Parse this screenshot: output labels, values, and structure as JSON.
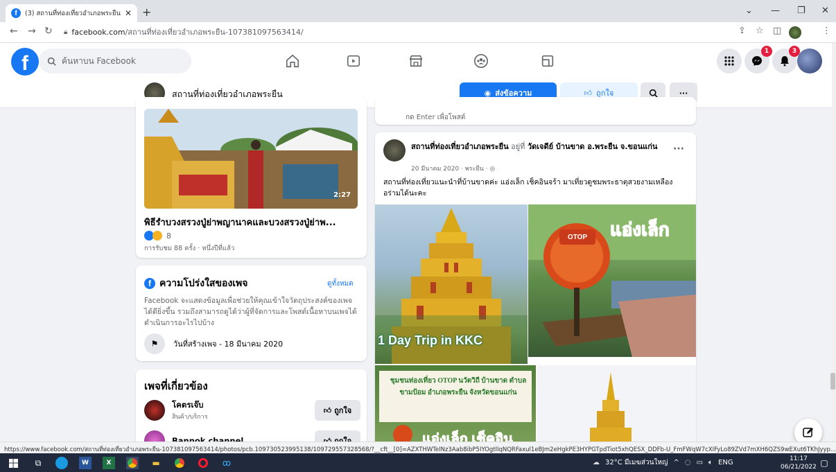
{
  "browser": {
    "tab_title": "(3) สถานที่ท่องเที่ยวอำเภอพระยืน | Fa",
    "url_domain": "facebook.com",
    "url_path": "/สถานที่ท่องเที่ยวอำเภอพระยืน-107381097563414/"
  },
  "fb": {
    "search_placeholder": "ค้นหาบน Facebook",
    "messenger_badge": "1",
    "notif_badge": "3"
  },
  "page": {
    "name": "สถานที่ท่องเที่ยวอำเภอพระยืน",
    "send_message": "ส่งข้อความ",
    "like": "ถูกใจ",
    "more": "···"
  },
  "video": {
    "duration": "2:27",
    "title": "พิธีรำบวงสรวงปู่ย่าพญานาคและบวงสรวงปู่ย่าพ...",
    "reactions": "8",
    "views": "การรับชม 88 ครั้ง · หนึ่งปีที่แล้ว"
  },
  "transparency": {
    "title": "ความโปร่งใสของเพจ",
    "see_all": "ดูทั้งหมด",
    "text": "Facebook จะแสดงข้อมูลเพื่อช่วยให้คุณเข้าใจวัตถุประสงค์ของเพจได้ดียิ่งขึ้น รวมถึงสามารถดูได้ว่าผู้ที่จัดการและโพสต์เนื้อหาบนเพจได้ดำเนินการอะไรไปบ้าง",
    "created": "วันที่สร้างเพจ - 18 มีนาคม 2020"
  },
  "related": {
    "title": "เพจที่เกี่ยวข้อง",
    "items": [
      {
        "name": "โคตรเจ๊บ",
        "sub": "สินค้า/บริการ",
        "like": "ถูกใจ"
      },
      {
        "name": "Bannok channel",
        "sub": "",
        "like": "ถูกใจ"
      }
    ]
  },
  "comment": {
    "enter_hint": "กด Enter เพื่อโพสต์"
  },
  "post": {
    "author": "สถานที่ท่องเที่ยวอำเภอพระยืน",
    "at": "อยู่ที่",
    "location": "วัดเจดีย์ บ้านขาด อ.พระยืน จ.ขอนแก่น",
    "meta": "20 มีนาคม 2020 · พระยืน · ◎",
    "text": "สถานที่ท่องเที่ยวแนะนำที่บ้านขาดค่ะ  แอ่งเล็ก เช็คอินจร้า มาเที่ยวดูชมพระธาตุสวยงามเหลืองอร่ามได้นะคะ",
    "img1_caption": "1 Day Trip in KKC",
    "img2_sign": "OTOP",
    "img2_title": "แอ่งเล็ก",
    "img3_banner": "ชุมชนท่องเที่ยว OTOP นวัตวิถี บ้านขาด ตำบลขามป้อม อำเภอพระยืน จังหวัดขอนแก่น",
    "img3_title": "แอ่งเล็ก เช็คอิน"
  },
  "statusbar": "https://www.facebook.com/สถานที่ท่องเที่ยวอำเภอพระยืน-107381097563414/photos/pcb.109730523995138/109729557328568/?__cft__[0]=AZXTHWTelNz3Aab8ibP5IYOgtlIqNQRFaxul1eBJm2eHgkPE3HYPGTpdTiot5xhQESX_DDFb-U_FmFWqW7cXIFyLo89ZVd7mXH6QZS9wEXut6TKhJyyp...",
  "taskbar": {
    "weather": "32°C มีเมฆส่วนใหญ่",
    "lang": "ENG",
    "time": "11:17",
    "date": "06/21/2022"
  },
  "colors": {
    "fb_blue": "#1877f2",
    "badge_red": "#e41e3f"
  }
}
